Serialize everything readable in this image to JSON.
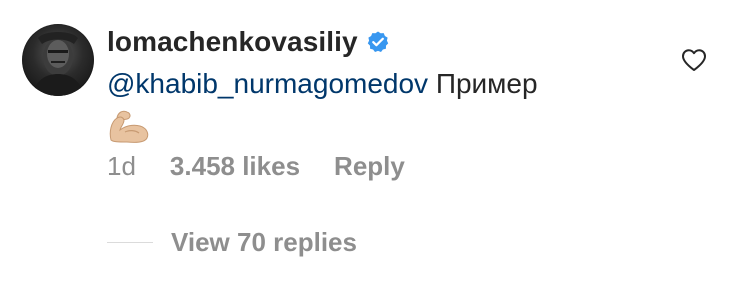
{
  "comment": {
    "username": "lomachenkovasiliy",
    "verified": true,
    "mention": "@khabib_nurmagomedov",
    "text": "Пример",
    "emoji": "flexed-biceps-emoji"
  },
  "meta": {
    "time": "1d",
    "likes": "3.458 likes",
    "reply": "Reply"
  },
  "replies": {
    "label": "View 70 replies"
  },
  "colors": {
    "text": "#262626",
    "secondary": "#8e8e8e",
    "mention": "#00376b",
    "verified": "#3897f0"
  },
  "icons": {
    "verified": "verified-badge-icon",
    "like": "heart-outline-icon"
  }
}
